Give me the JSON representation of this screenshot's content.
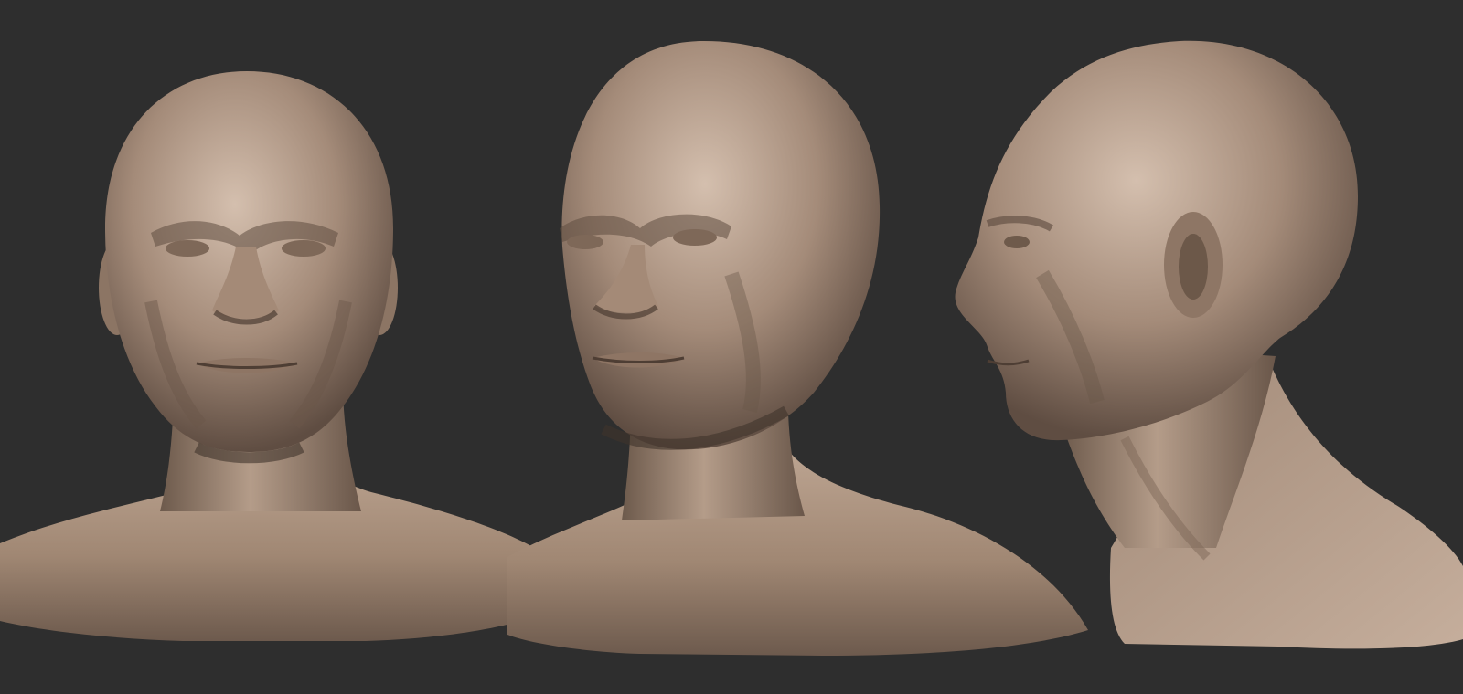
{
  "scene": {
    "background_color": "#2e2e2e",
    "material_color": "#b39b89",
    "views": [
      {
        "name": "front-view",
        "orientation": "front"
      },
      {
        "name": "three-quarter-view",
        "orientation": "three-quarter"
      },
      {
        "name": "side-view",
        "orientation": "profile"
      }
    ]
  }
}
